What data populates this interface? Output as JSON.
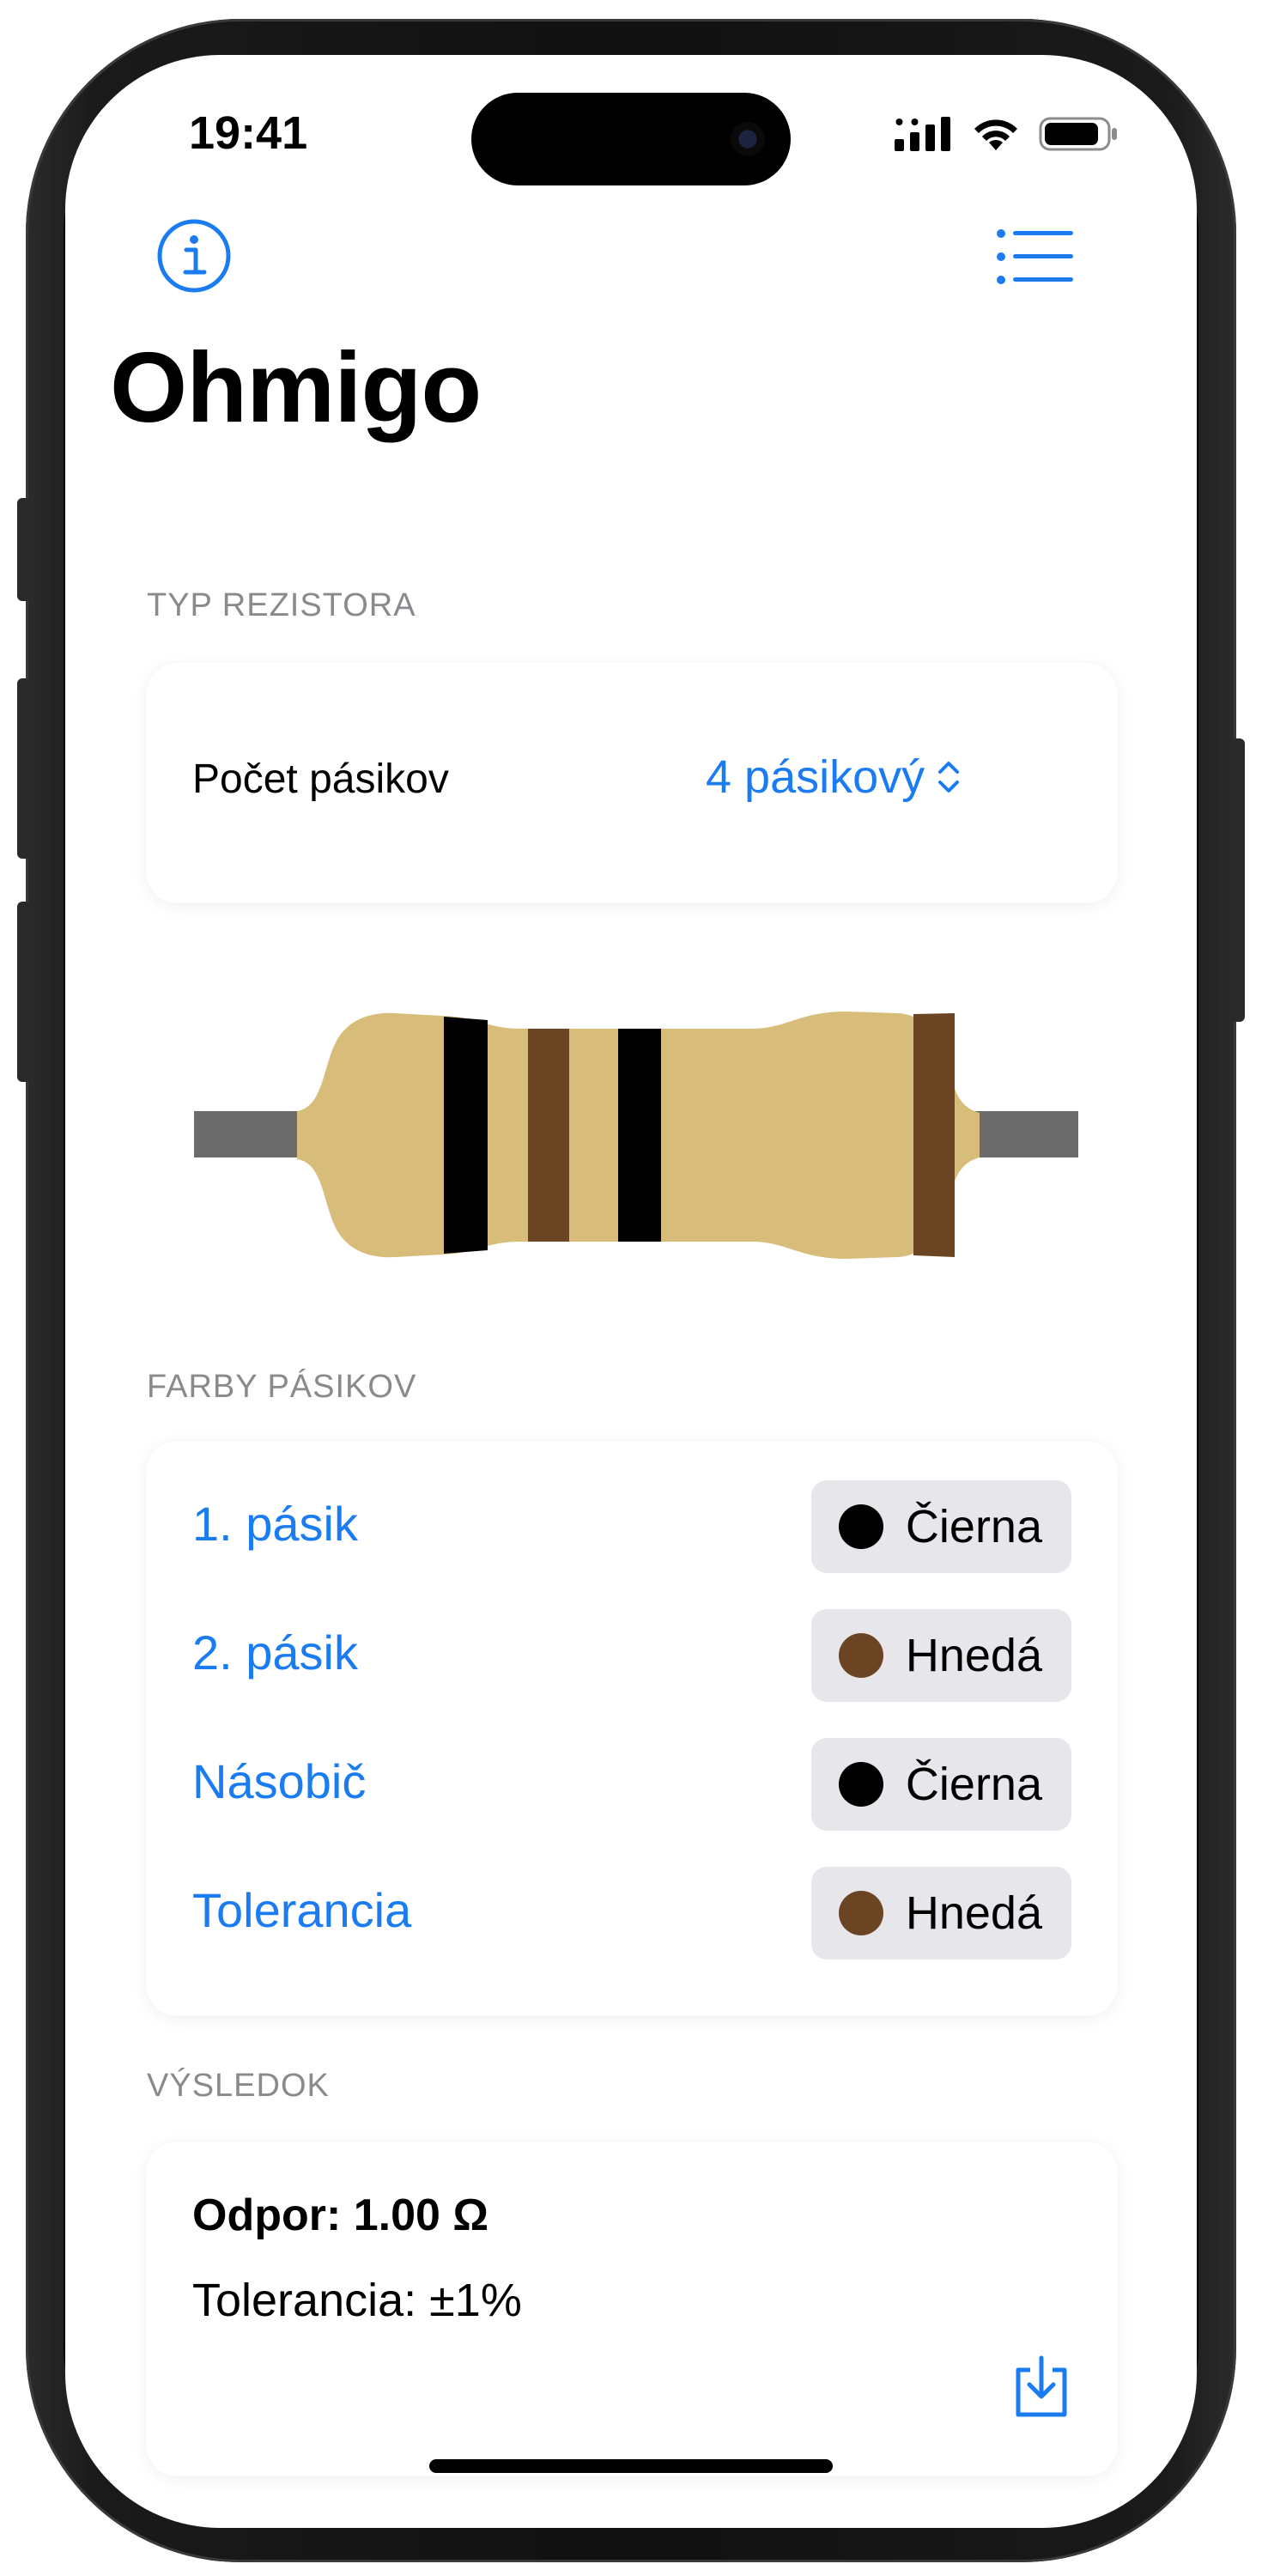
{
  "status": {
    "time": "19:41"
  },
  "app": {
    "title": "Ohmigo"
  },
  "nav": {
    "info_icon": "info-circle-icon",
    "list_icon": "list-bullet-icon"
  },
  "resistor_type": {
    "header": "TYP REZISTORA",
    "label": "Počet pásikov",
    "value": "4 pásikový",
    "value_icon": "chevron-up-down-icon"
  },
  "resistor": {
    "body_color": "#d8bc7a",
    "lead_color": "#6b6b6b",
    "bands": [
      {
        "name": "Čierna",
        "color": "#000000"
      },
      {
        "name": "Hnedá",
        "color": "#6b4423"
      },
      {
        "name": "Čierna",
        "color": "#000000"
      },
      {
        "name": "Hnedá",
        "color": "#6b4423"
      }
    ]
  },
  "band_colors": {
    "header": "FARBY PÁSIKOV",
    "rows": [
      {
        "label": "1. pásik",
        "color_name": "Čierna",
        "color": "#000000"
      },
      {
        "label": "2. pásik",
        "color_name": "Hnedá",
        "color": "#6b4423"
      },
      {
        "label": "Násobič",
        "color_name": "Čierna",
        "color": "#000000"
      },
      {
        "label": "Tolerancia",
        "color_name": "Hnedá",
        "color": "#6b4423"
      }
    ]
  },
  "result": {
    "header": "VÝSLEDOK",
    "resistance": "Odpor: 1.00 Ω",
    "tolerance": "Tolerancia: ±1%",
    "save_icon": "download-tray-icon"
  },
  "colors": {
    "accent": "#1a7cf0",
    "secondary_text": "#8a8a8e",
    "chip_bg": "#e6e6eb"
  }
}
